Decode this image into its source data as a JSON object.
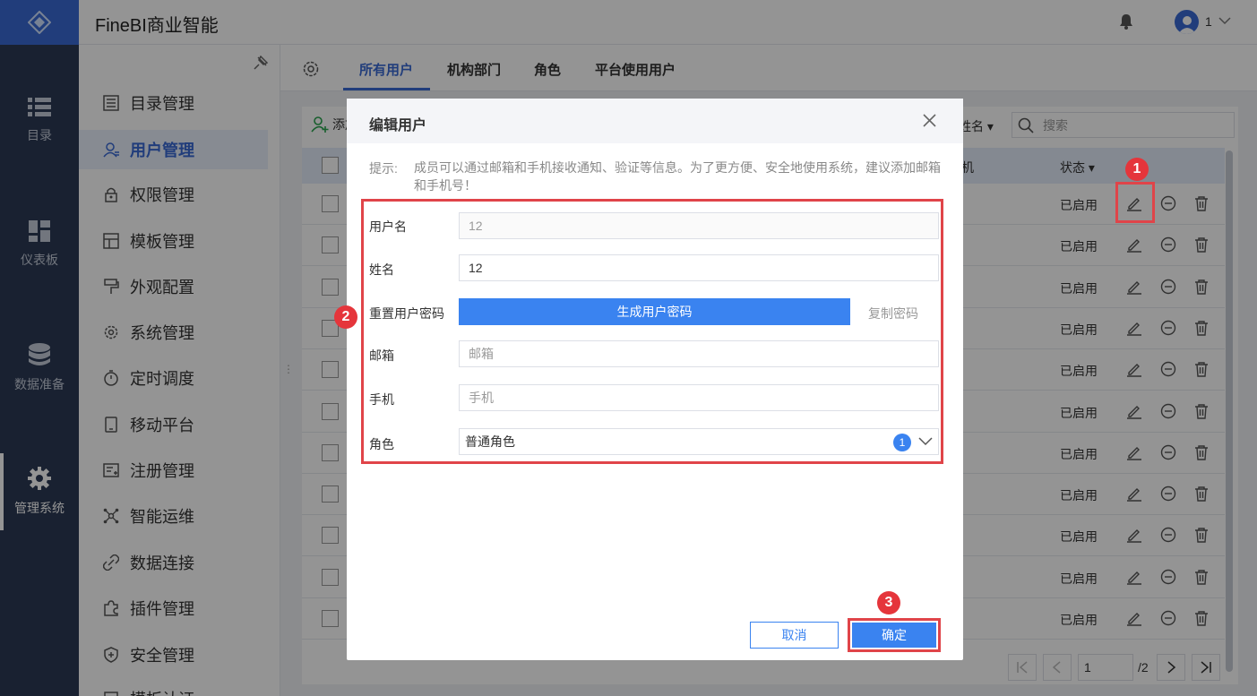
{
  "app": {
    "title": "FineBI商业智能"
  },
  "topbar": {
    "user_count": "1"
  },
  "leftnav": [
    {
      "label": "目录",
      "icon": "list-icon"
    },
    {
      "label": "仪表板",
      "icon": "dashboard-icon"
    },
    {
      "label": "数据准备",
      "icon": "database-icon"
    },
    {
      "label": "管理系统",
      "icon": "gear-icon"
    }
  ],
  "submenu": [
    {
      "label": "目录管理"
    },
    {
      "label": "用户管理"
    },
    {
      "label": "权限管理"
    },
    {
      "label": "模板管理"
    },
    {
      "label": "外观配置"
    },
    {
      "label": "系统管理"
    },
    {
      "label": "定时调度"
    },
    {
      "label": "移动平台"
    },
    {
      "label": "注册管理"
    },
    {
      "label": "智能运维"
    },
    {
      "label": "数据连接"
    },
    {
      "label": "插件管理"
    },
    {
      "label": "安全管理"
    },
    {
      "label": "模板认证"
    }
  ],
  "tabs": [
    {
      "label": "所有用户"
    },
    {
      "label": "机构部门"
    },
    {
      "label": "角色"
    },
    {
      "label": "平台使用用户"
    }
  ],
  "toolbar": {
    "add_user": "添加",
    "filter": "姓名",
    "search_placeholder": "搜索"
  },
  "table": {
    "col_phone": "机",
    "col_status": "状态",
    "rows": [
      {
        "status": "已启用"
      },
      {
        "status": "已启用"
      },
      {
        "status": "已启用"
      },
      {
        "status": "已启用"
      },
      {
        "status": "已启用"
      },
      {
        "status": "已启用"
      },
      {
        "status": "已启用"
      },
      {
        "status": "已启用"
      },
      {
        "status": "已启用"
      },
      {
        "status": "已启用"
      },
      {
        "status": "已启用"
      }
    ]
  },
  "pager": {
    "current": "1",
    "total": "/2"
  },
  "modal": {
    "title": "编辑用户",
    "hint_label": "提示:",
    "hint_text": "成员可以通过邮箱和手机接收通知、验证等信息。为了更方便、安全地使用系统，建议添加邮箱和手机号！",
    "username_label": "用户名",
    "username_value": "12",
    "name_label": "姓名",
    "name_value": "12",
    "reset_pw_label": "重置用户密码",
    "gen_pw_button": "生成用户密码",
    "copy_pw": "复制密码",
    "email_label": "邮箱",
    "email_placeholder": "邮箱",
    "phone_label": "手机",
    "phone_placeholder": "手机",
    "role_label": "角色",
    "role_value": "普通角色",
    "role_count": "1",
    "cancel": "取消",
    "ok": "确定"
  },
  "callouts": [
    "1",
    "2",
    "3"
  ],
  "colors": {
    "accent": "#3a83f0",
    "nav_bg": "#2c3a55",
    "highlight": "#e04449"
  }
}
